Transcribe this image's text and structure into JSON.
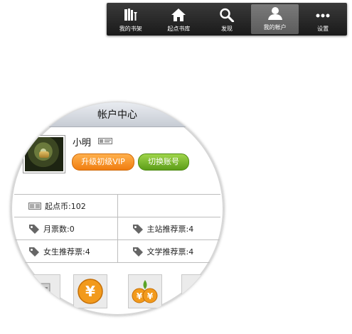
{
  "nav": {
    "items": [
      {
        "label": "我的书架",
        "icon": "bookshelf-icon",
        "active": false
      },
      {
        "label": "起点书库",
        "icon": "home-icon",
        "active": false
      },
      {
        "label": "发现",
        "icon": "search-icon",
        "active": false
      },
      {
        "label": "我的帐户",
        "icon": "user-icon",
        "active": true
      },
      {
        "label": "设置",
        "icon": "more-icon",
        "active": false
      }
    ]
  },
  "account": {
    "title": "帐户中心",
    "username": "小明",
    "vip_button": "升级初级VIP",
    "switch_button": "切换账号"
  },
  "stats": {
    "coins": "起点币:102",
    "monthly_votes": "月票数:0",
    "main_rec_votes": "主站推荐票:4",
    "female_rec_votes": "女生推荐票:4",
    "lit_rec_votes": "文学推荐票:4"
  },
  "colors": {
    "nav_bg": "#1f1f1f",
    "vip_orange": "#f07d10",
    "switch_green": "#5c9d18",
    "coin_orange": "#f29a1c"
  }
}
